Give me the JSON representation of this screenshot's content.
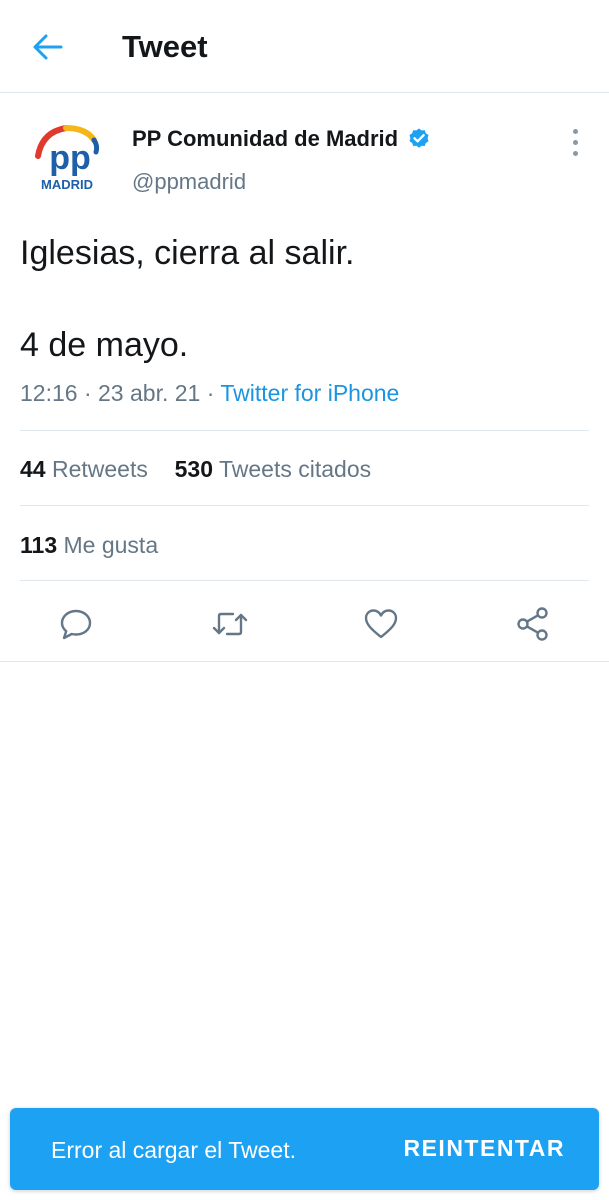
{
  "header": {
    "title": "Tweet",
    "back_icon": "arrow-left-icon"
  },
  "author": {
    "display_name": "PP Comunidad de Madrid",
    "handle": "@ppmadrid",
    "verified": true,
    "avatar": {
      "logo_text": "pp",
      "logo_subtext": "MADRID"
    }
  },
  "tweet": {
    "lines": [
      "Iglesias, cierra al salir.",
      "4 de mayo."
    ],
    "time": "12:16",
    "separator": "·",
    "date": "23 abr. 21",
    "source": "Twitter for iPhone"
  },
  "stats": {
    "retweets": {
      "count": "44",
      "label": "Retweets"
    },
    "quotes": {
      "count": "530",
      "label": "Tweets citados"
    },
    "likes": {
      "count": "113",
      "label": "Me gusta"
    }
  },
  "actions": [
    {
      "name": "reply",
      "icon": "comment-icon"
    },
    {
      "name": "retweet",
      "icon": "retweet-icon"
    },
    {
      "name": "like",
      "icon": "heart-icon"
    },
    {
      "name": "share",
      "icon": "share-icon"
    }
  ],
  "snackbar": {
    "message": "Error al cargar el Tweet.",
    "action_label": "REINTENTAR"
  },
  "colors": {
    "accent": "#1da1f2",
    "link": "#1b95e0",
    "text_primary": "#14171a",
    "text_secondary": "#657786",
    "border": "#e1e8ed",
    "logo_blue": "#1d5fa8",
    "logo_red": "#e03a2f",
    "logo_yellow": "#f5b61a"
  }
}
